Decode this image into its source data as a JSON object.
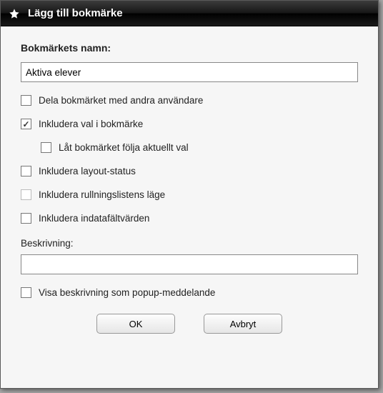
{
  "dialog": {
    "title": "Lägg till bokmärke"
  },
  "form": {
    "name_label": "Bokmärkets namn:",
    "name_value": "Aktiva elever",
    "share_label": "Dela bokmärket med andra användare",
    "share_checked": false,
    "include_sel_label": "Inkludera val i bokmärke",
    "include_sel_checked": true,
    "follow_sel_label": "Låt bokmärket följa aktuellt val",
    "follow_sel_checked": false,
    "include_layout_label": "Inkludera layout-status",
    "include_layout_checked": false,
    "include_scroll_label": "Inkludera rullningslistens läge",
    "include_scroll_checked": false,
    "include_input_label": "Inkludera indatafältvärden",
    "include_input_checked": false,
    "desc_label": "Beskrivning:",
    "desc_value": "",
    "popup_label": "Visa beskrivning som popup-meddelande",
    "popup_checked": false
  },
  "buttons": {
    "ok": "OK",
    "cancel": "Avbryt"
  }
}
